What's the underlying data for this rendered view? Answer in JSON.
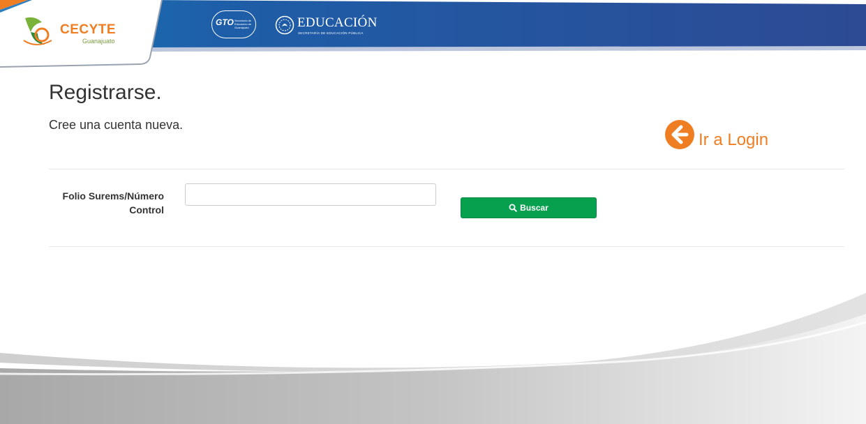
{
  "header": {
    "brand_name": "CECYTE",
    "brand_sub": "Guanajuato",
    "gto_text": "GTO",
    "gto_lines": "Secretaría de Educación de Guanajuato",
    "edu_title": "EDUCACIÓN",
    "edu_sub": "SECRETARÍA DE EDUCACIÓN PÚBLICA",
    "colors": {
      "banner_blue": "#2c4a93",
      "banner_light": "#1f6fb2",
      "accent_orange": "#ef7d22"
    }
  },
  "page": {
    "title": "Registrarse.",
    "subtitle": "Cree una cuenta nueva."
  },
  "login_link": {
    "label": "Ir a Login",
    "icon": "arrow-left-circle-icon"
  },
  "form": {
    "label": "Folio Surems/Número Control",
    "input_value": "",
    "input_placeholder": "",
    "button_label": "Buscar",
    "button_icon": "search-icon",
    "button_color": "#07a04f"
  }
}
